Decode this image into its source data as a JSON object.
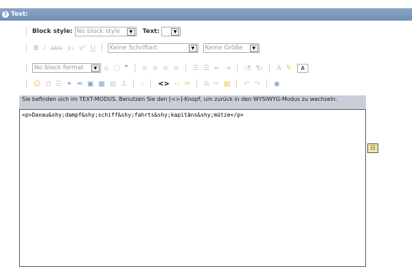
{
  "header": {
    "title": "Text:",
    "help_icon": "?"
  },
  "toolbar1": {
    "block_style_label": "Block style:",
    "block_style_value": "No block style",
    "text_label": "Text:",
    "text_value": ""
  },
  "toolbar2": {
    "font_value": "Keine Schriftart",
    "size_value": "Keine Größe"
  },
  "toolbar3": {
    "format_value": "No block format",
    "a_box": "A"
  },
  "toolbar4": {
    "source_toggle": "<>"
  },
  "notice": "Sie befinden sich im TEXT-MODUS. Benutzen Sie den [<>]-Knopf, um zurück in den WYSIWYG-Modus zu wechseln.",
  "editor": {
    "content": "<p>Danau&shy;dampf&shy;schiff&shy;fahrts&shy;kapitäns&shy;mütze</p>"
  },
  "colors": {
    "header": "#7a97bd",
    "notice_bg": "#c8cfd8",
    "separator": "#e8a040"
  }
}
